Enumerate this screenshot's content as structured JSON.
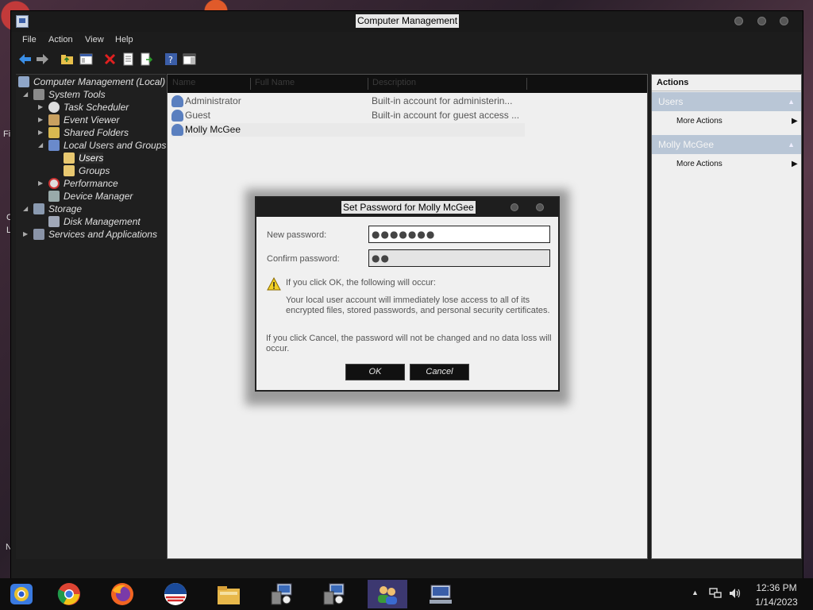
{
  "window": {
    "title": "Computer Management",
    "menu": [
      "File",
      "Action",
      "View",
      "Help"
    ]
  },
  "tree": {
    "root": "Computer Management (Local)",
    "system_tools": "System Tools",
    "task_scheduler": "Task Scheduler",
    "event_viewer": "Event Viewer",
    "shared_folders": "Shared Folders",
    "local_users_groups": "Local Users and Groups",
    "users": "Users",
    "groups": "Groups",
    "performance": "Performance",
    "device_manager": "Device Manager",
    "storage": "Storage",
    "disk_management": "Disk Management",
    "services_apps": "Services and Applications"
  },
  "list": {
    "columns": [
      "Name",
      "Full Name",
      "Description"
    ],
    "rows": [
      {
        "name": "Administrator",
        "description": "Built-in account for administerin..."
      },
      {
        "name": "Guest",
        "description": "Built-in account for guest access ..."
      },
      {
        "name": "Molly McGee",
        "description": ""
      }
    ]
  },
  "actions": {
    "title": "Actions",
    "section1": "Users",
    "section1_item": "More Actions",
    "section2": "Molly McGee",
    "section2_item": "More Actions"
  },
  "dialog": {
    "title": "Set Password for Molly McGee",
    "new_password_label": "New password:",
    "new_password_value": "●●●●●●●",
    "confirm_password_label": "Confirm password:",
    "confirm_password_value": "●●",
    "warning_heading": "If you click OK, the following will occur:",
    "warning_body": "Your local user account will immediately lose access to all of its encrypted files, stored passwords, and personal security certificates.",
    "cancel_note": "If you click Cancel, the password will not be changed and no data loss will occur.",
    "ok_label": "OK",
    "cancel_label": "Cancel"
  },
  "taskbar": {
    "time": "12:36 PM",
    "date": "1/14/2023",
    "apps": [
      "chromium-icon",
      "chrome-icon",
      "firefox-icon",
      "obama-logo-icon",
      "file-explorer-icon",
      "network-tool-icon",
      "network-tool-2-icon",
      "user-accounts-icon",
      "computer-management-icon"
    ]
  }
}
